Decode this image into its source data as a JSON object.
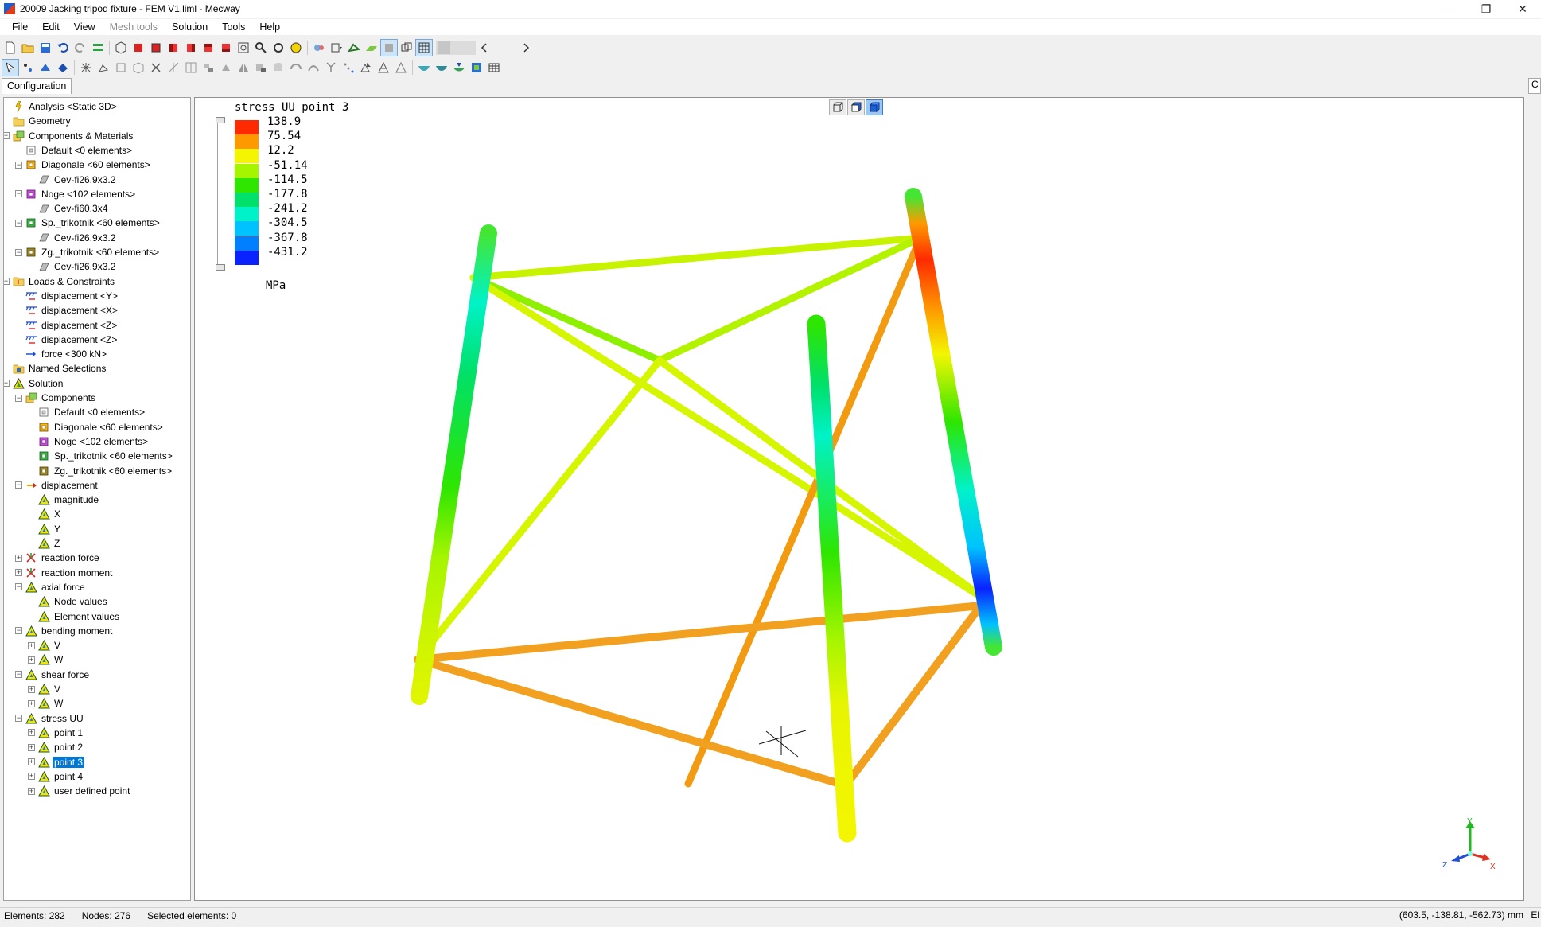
{
  "window": {
    "title": "20009 Jacking tripod fixture - FEM V1.liml - Mecway",
    "minimize": "—",
    "restore": "❐",
    "close": "✕"
  },
  "menu": [
    "File",
    "Edit",
    "View",
    "Mesh tools",
    "Solution",
    "Tools",
    "Help"
  ],
  "left_panel": {
    "tab": "Configuration",
    "tree": [
      {
        "label": "Analysis <Static 3D>",
        "level": 1,
        "icon": "analysis-icon",
        "exp": ""
      },
      {
        "label": "Geometry",
        "level": 1,
        "icon": "folder-icon",
        "exp": ""
      },
      {
        "label": "Components & Materials",
        "level": 1,
        "icon": "components-icon",
        "exp": "−"
      },
      {
        "label": "Default <0 elements>",
        "level": 2,
        "icon": "component-empty-icon",
        "exp": ""
      },
      {
        "label": "Diagonale <60 elements>",
        "level": 2,
        "icon": "component-orange-icon",
        "exp": "−"
      },
      {
        "label": "Cev-fi26.9x3.2",
        "level": 3,
        "icon": "section-icon",
        "exp": ""
      },
      {
        "label": "Noge <102 elements>",
        "level": 2,
        "icon": "component-purple-icon",
        "exp": "−"
      },
      {
        "label": "Cev-fi60.3x4",
        "level": 3,
        "icon": "section-icon",
        "exp": ""
      },
      {
        "label": "Sp._trikotnik <60 elements>",
        "level": 2,
        "icon": "component-green-icon",
        "exp": "−"
      },
      {
        "label": "Cev-fi26.9x3.2",
        "level": 3,
        "icon": "section-icon",
        "exp": ""
      },
      {
        "label": "Zg._trikotnik <60 elements>",
        "level": 2,
        "icon": "component-olive-icon",
        "exp": "−"
      },
      {
        "label": "Cev-fi26.9x3.2",
        "level": 3,
        "icon": "section-icon",
        "exp": ""
      },
      {
        "label": "Loads & Constraints",
        "level": 1,
        "icon": "loads-icon",
        "exp": "−"
      },
      {
        "label": "displacement <Y>",
        "level": 2,
        "icon": "displacement-constraint-icon",
        "exp": ""
      },
      {
        "label": "displacement <X>",
        "level": 2,
        "icon": "displacement-constraint-icon",
        "exp": ""
      },
      {
        "label": "displacement <Z>",
        "level": 2,
        "icon": "displacement-constraint-icon",
        "exp": ""
      },
      {
        "label": "displacement <Z>",
        "level": 2,
        "icon": "displacement-constraint-icon",
        "exp": ""
      },
      {
        "label": "force <300 kN>",
        "level": 2,
        "icon": "force-icon",
        "exp": ""
      },
      {
        "label": "Named Selections",
        "level": 1,
        "icon": "named-selections-icon",
        "exp": ""
      },
      {
        "label": "Solution",
        "level": 1,
        "icon": "solution-icon",
        "exp": "−"
      },
      {
        "label": "Components",
        "level": 2,
        "icon": "components-icon",
        "exp": "−"
      },
      {
        "label": "Default <0 elements>",
        "level": 3,
        "icon": "component-empty-icon",
        "exp": ""
      },
      {
        "label": "Diagonale <60 elements>",
        "level": 3,
        "icon": "component-orange-icon",
        "exp": ""
      },
      {
        "label": "Noge <102 elements>",
        "level": 3,
        "icon": "component-purple-icon",
        "exp": ""
      },
      {
        "label": "Sp._trikotnik <60 elements>",
        "level": 3,
        "icon": "component-green-icon",
        "exp": ""
      },
      {
        "label": "Zg._trikotnik <60 elements>",
        "level": 3,
        "icon": "component-olive-icon",
        "exp": ""
      },
      {
        "label": "displacement",
        "level": 2,
        "icon": "displacement-result-icon",
        "exp": "−"
      },
      {
        "label": "magnitude",
        "level": 3,
        "icon": "result-triangle-icon",
        "exp": ""
      },
      {
        "label": "X",
        "level": 3,
        "icon": "result-triangle-icon",
        "exp": ""
      },
      {
        "label": "Y",
        "level": 3,
        "icon": "result-triangle-icon",
        "exp": ""
      },
      {
        "label": "Z",
        "level": 3,
        "icon": "result-triangle-icon",
        "exp": ""
      },
      {
        "label": "reaction force",
        "level": 2,
        "icon": "reaction-icon",
        "exp": "+"
      },
      {
        "label": "reaction moment",
        "level": 2,
        "icon": "reaction-icon",
        "exp": "+"
      },
      {
        "label": "axial force",
        "level": 2,
        "icon": "result-triangle-icon",
        "exp": "−"
      },
      {
        "label": "Node values",
        "level": 3,
        "icon": "result-triangle-icon",
        "exp": ""
      },
      {
        "label": "Element values",
        "level": 3,
        "icon": "result-triangle-icon",
        "exp": ""
      },
      {
        "label": "bending moment",
        "level": 2,
        "icon": "result-triangle-icon",
        "exp": "−"
      },
      {
        "label": "V",
        "level": 3,
        "icon": "result-triangle-icon",
        "exp": "+"
      },
      {
        "label": "W",
        "level": 3,
        "icon": "result-triangle-icon",
        "exp": "+"
      },
      {
        "label": "shear force",
        "level": 2,
        "icon": "result-triangle-icon",
        "exp": "−"
      },
      {
        "label": "V",
        "level": 3,
        "icon": "result-triangle-icon",
        "exp": "+"
      },
      {
        "label": "W",
        "level": 3,
        "icon": "result-triangle-icon",
        "exp": "+"
      },
      {
        "label": "stress UU",
        "level": 2,
        "icon": "result-triangle-icon",
        "exp": "−"
      },
      {
        "label": "point 1",
        "level": 3,
        "icon": "result-triangle-icon",
        "exp": "+"
      },
      {
        "label": "point 2",
        "level": 3,
        "icon": "result-triangle-icon",
        "exp": "+"
      },
      {
        "label": "point 3",
        "level": 3,
        "icon": "result-triangle-icon",
        "exp": "+",
        "selected": true
      },
      {
        "label": "point 4",
        "level": 3,
        "icon": "result-triangle-icon",
        "exp": "+"
      },
      {
        "label": "user defined point",
        "level": 3,
        "icon": "result-triangle-icon",
        "exp": "+"
      }
    ]
  },
  "viewport": {
    "result_title": "stress UU point 3",
    "legend": {
      "labels": [
        "138.9",
        "75.54",
        "12.2",
        "-51.14",
        "-114.5",
        "-177.8",
        "-241.2",
        "-304.5",
        "-367.8",
        "-431.2"
      ],
      "colors": [
        "#ff2a00",
        "#ff9900",
        "#f3f600",
        "#a6f500",
        "#2ee600",
        "#00e06a",
        "#00f2c8",
        "#00c2ff",
        "#0080ff",
        "#0a22ff"
      ],
      "unit": "MPa"
    },
    "axes": {
      "x": "X",
      "y": "Y",
      "z": "Z"
    }
  },
  "status": {
    "elements": "Elements: 282",
    "nodes": "Nodes: 276",
    "selected": "Selected elements: 0",
    "coords": "(603.5, -138.81, -562.73) mm",
    "cut": "El"
  },
  "right_panel": {
    "tab": "C"
  }
}
